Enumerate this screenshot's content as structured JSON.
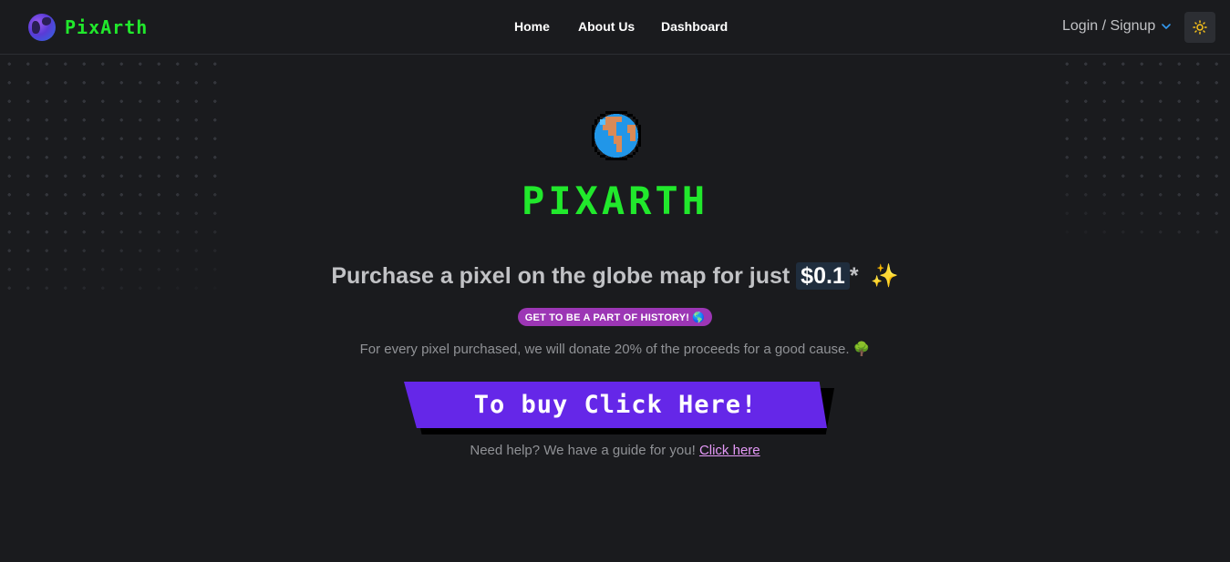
{
  "header": {
    "brand": "PixArth",
    "nav": {
      "home": "Home",
      "about": "About Us",
      "dashboard": "Dashboard"
    },
    "login_label": "Login / Signup",
    "icons": {
      "brand": "globe-logo-icon",
      "chevron": "chevron-down-icon",
      "theme": "sun-icon"
    }
  },
  "hero": {
    "title": "PIXARTH",
    "globe_icon": "pixel-globe-icon",
    "headline_prefix": "Purchase a pixel on the globe map for just",
    "price": "$0.1",
    "price_suffix": "*",
    "sparkles": "✨",
    "badge": "GET TO BE A PART OF HISTORY! 🌎",
    "donation_text": "For every pixel purchased, we will donate 20% of the proceeds for a good cause. 🌳",
    "cta_label": "To buy Click Here!",
    "help_text": "Need help? We have a guide for you!",
    "help_link": "Click here"
  },
  "colors": {
    "background": "#1a1b1e",
    "brand_green": "#21e82c",
    "cta_purple": "#6527e8",
    "badge_purple": "#9c36b5",
    "link_pink": "#e599f7"
  }
}
